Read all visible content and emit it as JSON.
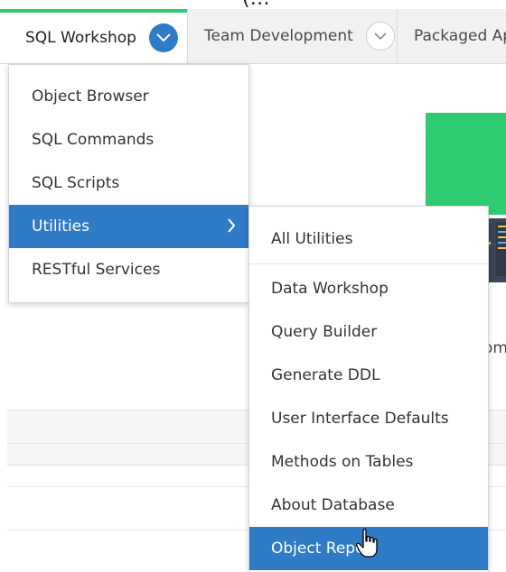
{
  "header_partial": "(…",
  "tabs": [
    {
      "label": "SQL Workshop",
      "active": true
    },
    {
      "label": "Team Development",
      "active": false
    },
    {
      "label": "Packaged Ap",
      "active": false
    }
  ],
  "sql_workshop_menu": {
    "items": [
      {
        "label": "Object Browser"
      },
      {
        "label": "SQL Commands"
      },
      {
        "label": "SQL Scripts"
      },
      {
        "label": "Utilities",
        "highlighted": true,
        "has_submenu": true
      },
      {
        "label": "RESTful Services"
      }
    ]
  },
  "utilities_submenu": {
    "items": [
      {
        "label": "All Utilities"
      },
      {
        "label": "Data Workshop"
      },
      {
        "label": "Query Builder"
      },
      {
        "label": "Generate DDL"
      },
      {
        "label": "User Interface Defaults"
      },
      {
        "label": "Methods on Tables"
      },
      {
        "label": "About Database"
      },
      {
        "label": "Object Repo",
        "highlighted": true
      }
    ]
  },
  "background": {
    "partial_label": "om"
  },
  "colors": {
    "accent_blue": "#2f7bc6",
    "accent_green": "#2ecc71"
  },
  "icons": [
    "chevron-down-icon",
    "chevron-right-icon",
    "hand-cursor-icon",
    "code-editor-illustration"
  ]
}
